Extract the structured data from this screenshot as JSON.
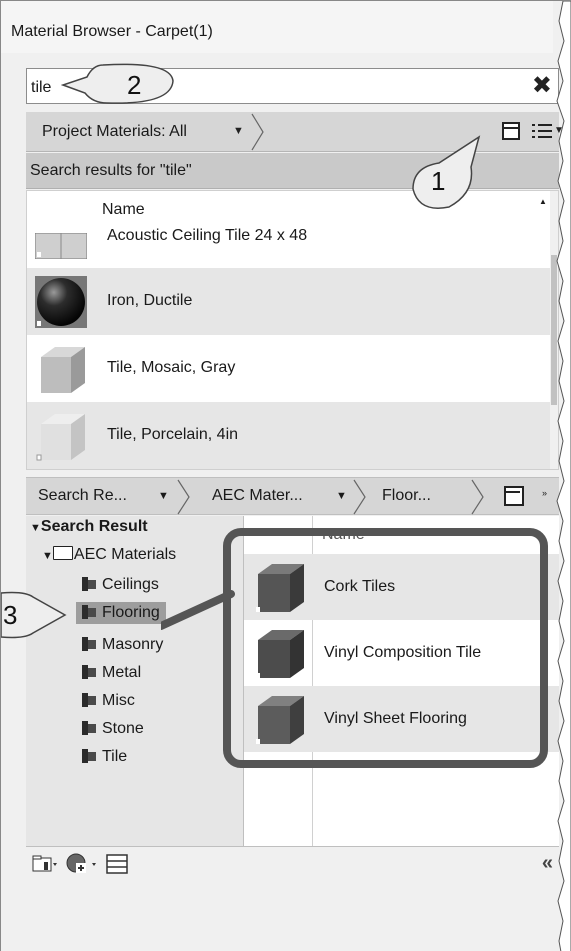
{
  "title": "Material Browser - Carpet(1)",
  "search": {
    "value": "tile"
  },
  "filter": {
    "label": "Project Materials: All"
  },
  "results_header": "Search results for \"tile\"",
  "results": {
    "column": "Name",
    "items": [
      {
        "name": "Acoustic Ceiling Tile 24 x 48"
      },
      {
        "name": "Iron, Ductile"
      },
      {
        "name": "Tile, Mosaic, Gray"
      },
      {
        "name": "Tile, Porcelain, 4in"
      }
    ]
  },
  "breadcrumbs": [
    "Search Re...",
    "AEC Mater...",
    "Floor..."
  ],
  "tree": {
    "root": "Search Result",
    "folder": "AEC Materials",
    "categories": [
      "Ceilings",
      "Flooring",
      "Masonry",
      "Metal",
      "Misc",
      "Stone",
      "Tile"
    ]
  },
  "materials": {
    "column": "Name",
    "items": [
      {
        "name": "Cork Tiles"
      },
      {
        "name": "Vinyl Composition Tile"
      },
      {
        "name": "Vinyl Sheet Flooring"
      }
    ]
  },
  "callouts": [
    "1",
    "2",
    "3"
  ],
  "colors": {
    "highlight": "#555555",
    "callout_fill": "#eeeeee",
    "selected": "#9d9d9d"
  },
  "icons": [
    "close-icon",
    "view-toggle-icon",
    "list-view-icon",
    "library-icon",
    "globe-add-icon",
    "panel-icon",
    "collapse-icon"
  ]
}
